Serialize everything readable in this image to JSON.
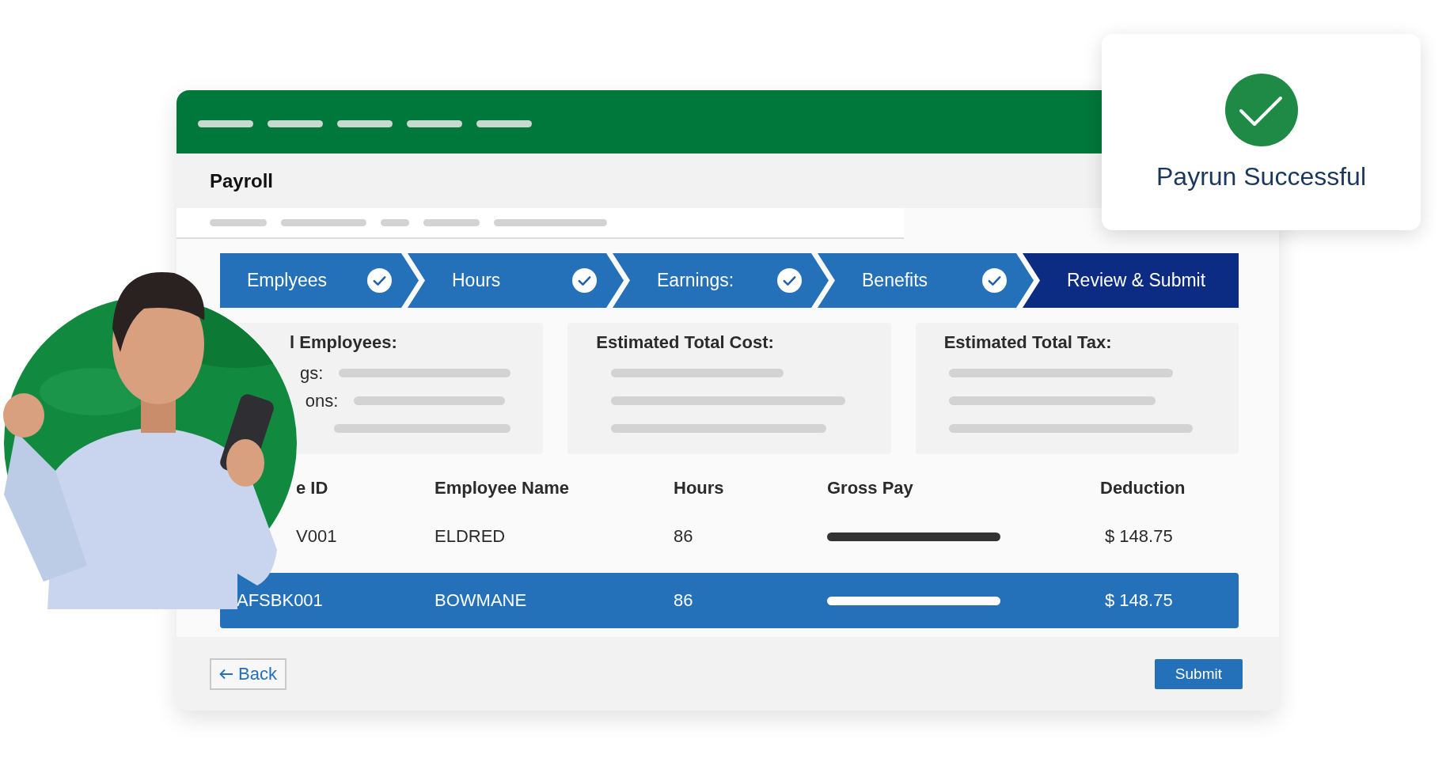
{
  "window": {
    "title": "Payroll"
  },
  "steps": [
    {
      "label": "Emplyees",
      "completed": true,
      "selected": false
    },
    {
      "label": "Hours",
      "completed": true,
      "selected": false
    },
    {
      "label": "Earnings:",
      "completed": true,
      "selected": false
    },
    {
      "label": "Benefits",
      "completed": true,
      "selected": false
    },
    {
      "label": "Review & Submit",
      "completed": false,
      "selected": true
    }
  ],
  "summary_cards": [
    {
      "title": "l Employees:",
      "row_labels": [
        "gs:",
        "ons:"
      ]
    },
    {
      "title": "Estimated Total Cost:"
    },
    {
      "title": "Estimated Total Tax:"
    }
  ],
  "table": {
    "columns": [
      "e ID",
      "Employee Name",
      "Hours",
      "Gross Pay",
      "Deduction"
    ],
    "rows": [
      {
        "id": "V001",
        "name": "ELDRED",
        "hours": "86",
        "deduction": "$ 148.75",
        "selected": false
      },
      {
        "id": "AFSBK001",
        "name": "BOWMANE",
        "hours": "86",
        "deduction": "$ 148.75",
        "selected": true
      }
    ]
  },
  "buttons": {
    "back": "Back",
    "submit": "Submit"
  },
  "toast": {
    "message": "Payrun Successful"
  }
}
